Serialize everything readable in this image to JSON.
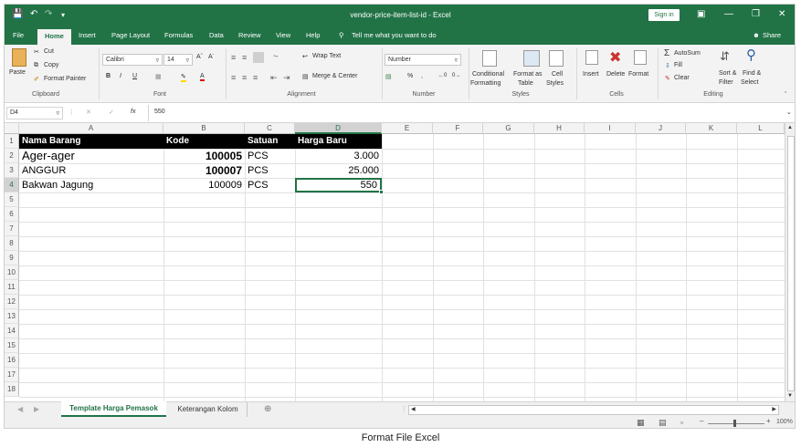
{
  "app": {
    "title": "vendor-price-item-list-id - Excel",
    "sign_in": "Sign in",
    "share": "Share"
  },
  "tabs": [
    "File",
    "Home",
    "Insert",
    "Page Layout",
    "Formulas",
    "Data",
    "Review",
    "View",
    "Help",
    "Tell me what you want to do"
  ],
  "ribbon": {
    "clipboard": {
      "paste": "Paste",
      "cut": "Cut",
      "copy": "Copy",
      "format_painter": "Format Painter",
      "label": "Clipboard"
    },
    "font": {
      "name": "Calibri",
      "size": "14",
      "bold": "B",
      "italic": "I",
      "underline": "U",
      "label": "Font"
    },
    "alignment": {
      "wrap_text": "Wrap Text",
      "merge": "Merge & Center",
      "label": "Alignment"
    },
    "number": {
      "format": "Number",
      "percent": "%",
      "comma": ",",
      "label": "Number"
    },
    "styles": {
      "conditional": "Conditional",
      "formatting": "Formatting",
      "format_as": "Format as",
      "table": "Table",
      "cell": "Cell",
      "styles": "Styles",
      "label": "Styles"
    },
    "cells": {
      "insert": "Insert",
      "delete": "Delete",
      "format": "Format",
      "label": "Cells"
    },
    "editing": {
      "autosum": "AutoSum",
      "fill": "Fill",
      "clear": "Clear",
      "sort": "Sort &",
      "filter": "Filter",
      "find": "Find &",
      "select": "Select",
      "label": "Editing"
    }
  },
  "formula_bar": {
    "name_box": "D4",
    "fx": "fx",
    "value": "550"
  },
  "columns": [
    "A",
    "B",
    "C",
    "D",
    "E",
    "F",
    "G",
    "H",
    "I",
    "J",
    "K",
    "L"
  ],
  "rows": [
    "1",
    "2",
    "3",
    "4",
    "5",
    "6",
    "7",
    "8",
    "9",
    "10",
    "11",
    "12",
    "13",
    "14",
    "15",
    "16",
    "17",
    "18"
  ],
  "table": {
    "headers": [
      "Nama Barang",
      "Kode",
      "Satuan",
      "Harga Baru"
    ],
    "rows": [
      [
        "Ager-ager",
        "100005",
        "PCS",
        "3.000"
      ],
      [
        "ANGGUR",
        "100007",
        "PCS",
        "25.000"
      ],
      [
        "Bakwan Jagung",
        "100009",
        "PCS",
        "550"
      ]
    ]
  },
  "sheets": [
    "Template Harga Pemasok",
    "Keterangan Kolom"
  ],
  "status": {
    "zoom": "100%"
  },
  "caption": "Format File Excel",
  "colors": {
    "accent": "#217346",
    "header_fill": "#000000"
  }
}
